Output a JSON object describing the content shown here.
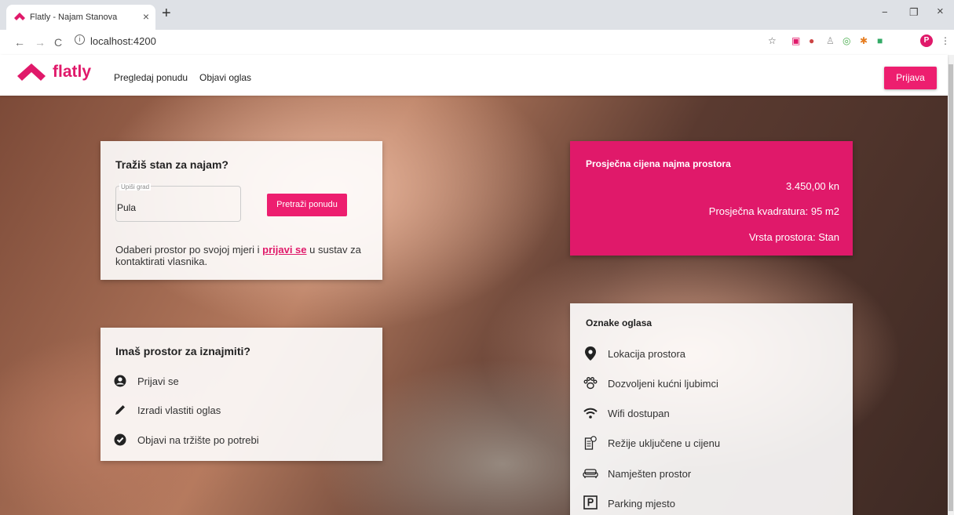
{
  "browser": {
    "tab_title": "Flatly - Najam Stanova",
    "tab_close": "×",
    "new_tab": "+",
    "url": "localhost:4200",
    "win_min": "−",
    "win_max": "❐",
    "win_close": "×",
    "profile_initial": "P"
  },
  "header": {
    "logo_text": "flatly",
    "nav": [
      "Pregledaj ponudu",
      "Objavi oglas"
    ],
    "login_label": "Prijava",
    "accent_color": "#e0196a"
  },
  "search_card": {
    "title": "Tražiš stan za najam?",
    "field_label": "Upiši grad",
    "field_value": "Pula",
    "search_button": "Pretraži ponudu",
    "note_before": "Odaberi prostor po svojoj mjeri i ",
    "note_link": "prijavi se",
    "note_after": " u sustav za kontaktirati vlasnika."
  },
  "owner_card": {
    "title": "Imaš prostor za iznajmiti?",
    "items": [
      {
        "icon": "user-circle-icon",
        "label": "Prijavi se"
      },
      {
        "icon": "pencil-icon",
        "label": "Izradi vlastiti oglas"
      },
      {
        "icon": "check-circle-icon",
        "label": "Objavi na tržište po potrebi"
      }
    ]
  },
  "price_card": {
    "title": "Prosječna cijena najma prostora",
    "price": "3.450,00 kn",
    "area": "Prosječna kvadratura: 95 m2",
    "type": "Vrsta prostora: Stan"
  },
  "features_card": {
    "title": "Oznake oglasa",
    "items": [
      {
        "icon": "location-pin-icon",
        "label": "Lokacija prostora"
      },
      {
        "icon": "paw-icon",
        "label": "Dozvoljeni kućni ljubimci"
      },
      {
        "icon": "wifi-icon",
        "label": "Wifi dostupan"
      },
      {
        "icon": "receipt-icon",
        "label": "Režije uključene u cijenu"
      },
      {
        "icon": "sofa-icon",
        "label": "Namješten prostor"
      },
      {
        "icon": "parking-icon",
        "label": "Parking mjesto"
      }
    ]
  }
}
